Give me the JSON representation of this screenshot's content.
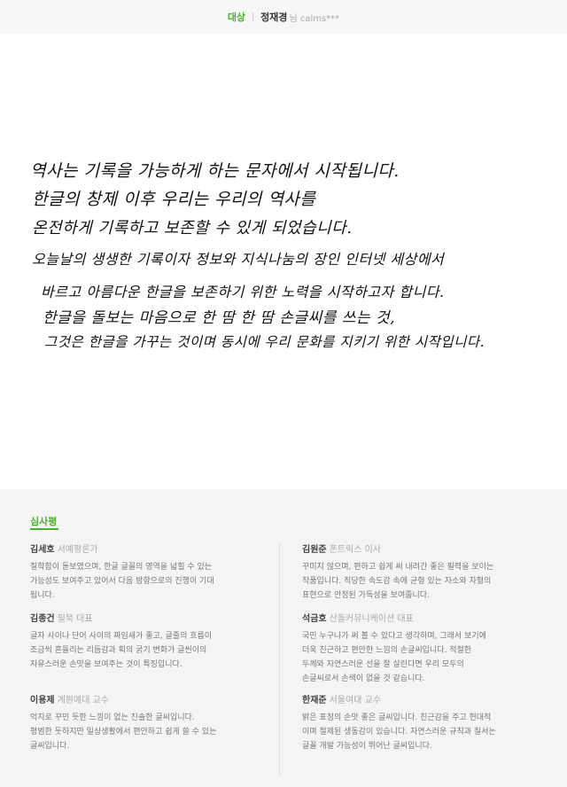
{
  "header": {
    "award": "대상",
    "winner_name": "정재경",
    "winner_suffix": "님 calms***"
  },
  "handwriting": {
    "lines": [
      "역사는 기록을 가능하게 하는 문자에서 시작됩니다.",
      "한글의 창제 이후 우리는 우리의 역사를",
      "온전하게 기록하고 보존할 수 있게 되었습니다.",
      "오늘날의 생생한 기록이자 정보와 지식나눔의 장인 인터넷 세상에서",
      "바르고 아름다운 한글을 보존하기 위한 노력을 시작하고자 합니다.",
      "한글을 돌보는 마음으로 한 땀 한 땀 손글씨를 쓰는 것,",
      "그것은 한글을 가꾸는 것이며 동시에 우리 문화를 지키기 위한 시작입니다."
    ]
  },
  "review": {
    "title": "심사평",
    "judges": [
      {
        "name": "김세호",
        "role": "서예평론가",
        "lines": [
          "칠학함이 돋보였으며, 한글 글꼴의 영역을 넓힐 수 있는",
          "가능성도 보여주고 있어서 다음 방향으로의 진행이 기대",
          "됩니다."
        ]
      },
      {
        "name": "김종건",
        "role": "필묵 대표",
        "lines": [
          "글자 사이나 단어 사이의 짜임새가 좋고, 글줄의 흐름이",
          "조금씩 흔들리는 리듬감과 획의 굵기 변화가 글씬이의",
          "자유스러운 손맛을 보여주는 것이 특징입니다."
        ]
      },
      {
        "name": "이용제",
        "role": "계원예대 교수",
        "lines": [
          "억지로 꾸민 듯한 느낌이 없는 진솔한 글씨입니다.",
          "평범한 듯하지만 일상생활에서 편안하고 쉽게 쓸 수 있는",
          "글씨입니다."
        ]
      },
      {
        "name": "김원준",
        "role": "폰트릭스 이사",
        "lines": [
          "꾸미지 않으며, 편하고 쉽게 써 내려간 좋은 필력을 보이는",
          "작품입니다. 적당한 속도감 속에 균형 있는 자소와 자형의",
          "표현으로 안정된 가독성을 보여줍니다."
        ]
      },
      {
        "name": "석금호",
        "role": "산돌커뮤니케이션 대표",
        "lines": [
          "국민 누구나가 써 볼 수 있다고 생각하며, 그래서 보기에",
          "더욱 친근하고 편안한 느낌의 손글씨입니다. 적절한",
          "두께와 자연스러운 선을 잘 살린다면 우리 모두의",
          "손글씨로서 손색이 없을 것 같습니다."
        ]
      },
      {
        "name": "한재준",
        "role": "서울여대 교수",
        "lines": [
          "밝은 표정의 손맛 좋은 글씨입니다. 친근감을 주고 현대적",
          "이며 절제된 생동감이 있습니다. 자연스러운 규칙과 질서는",
          "글꼴 개발 가능성이 뛰어난 글씨입니다."
        ]
      }
    ]
  }
}
